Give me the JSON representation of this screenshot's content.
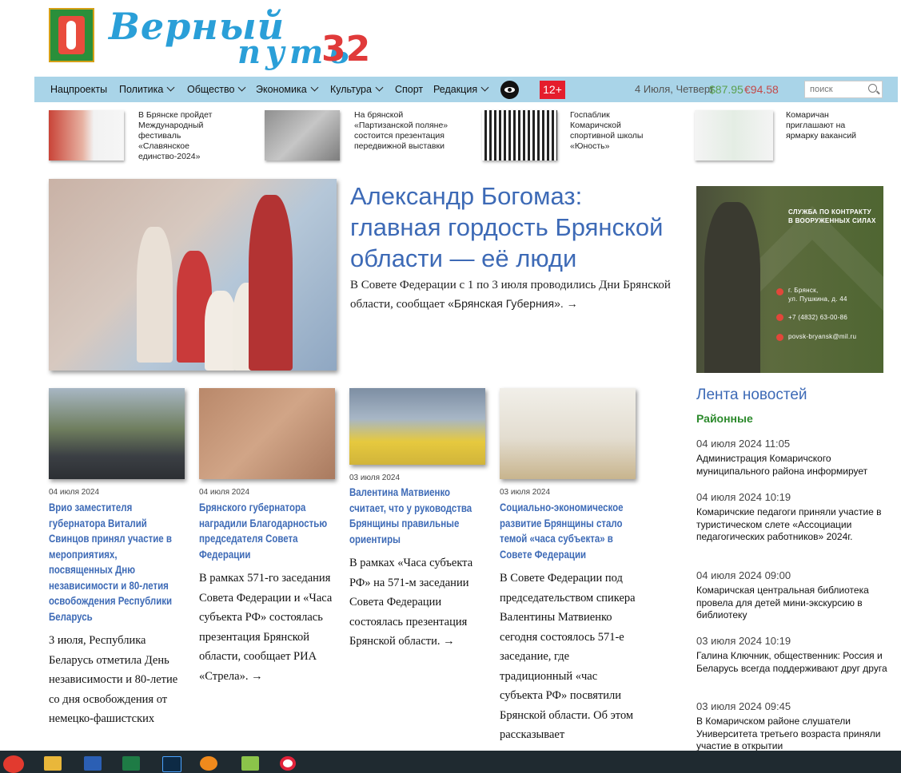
{
  "header": {
    "logo_title": "Верный",
    "logo_sub": "путь",
    "logo_number": "32"
  },
  "nav": {
    "items": [
      {
        "label": "Нацпроекты",
        "dropdown": false
      },
      {
        "label": "Политика",
        "dropdown": true
      },
      {
        "label": "Общество",
        "dropdown": true
      },
      {
        "label": "Экономика",
        "dropdown": true
      },
      {
        "label": "Культура",
        "dropdown": true
      },
      {
        "label": "Спорт",
        "dropdown": false
      },
      {
        "label": "Редакция",
        "dropdown": true
      }
    ],
    "age_rating": "12+",
    "date": "4 Июля, Четверг",
    "usd_rate": "$87.95",
    "eur_rate": "€94.58",
    "search_placeholder": "поиск"
  },
  "strip": [
    {
      "text": "В Брянске пройдет Международный фестиваль «Славянское единство-2024»"
    },
    {
      "text": "На брянской «Партизанской поляне» состоится презентация передвижной выставки"
    },
    {
      "text": "Госпаблик Комаричской спортивной школы «Юность»"
    },
    {
      "text": "Комаричан приглашают на ярмарку вакансий"
    }
  ],
  "main": {
    "title": "Александр Богомаз: главная гордость Брянской области — её люди",
    "lead": "В Совете Федерации с 1 по 3 июля проводились Дни Брянской области, сообщает ",
    "link": "«Брянская Губерния». →"
  },
  "ad": {
    "line1": "СЛУЖБА ПО КОНТРАКТУ",
    "line2": "В ВООРУЖЕННЫХ СИЛАХ",
    "address1": "г. Брянск,",
    "address2": "ул. Пушкина, д. 44",
    "phone": "+7 (4832) 63-00-86",
    "email": "povsk-bryansk@mil.ru"
  },
  "cards": [
    {
      "date": "04 июля 2024",
      "title": "Врио заместителя губернатора Виталий Свинцов принял участие в мероприятиях, посвященных Дню независимости и 80-летия освобождения Республики Беларусь",
      "body": "3 июля, Республика Беларусь отметила День независимости и 80-летие со дня освобождения от немецко-фашистских"
    },
    {
      "date": "04 июля 2024",
      "title": "Брянского губернатора наградили Благодарностью председателя Совета Федерации",
      "body": "В рамках 571-го заседания Совета Федерации и «Часа субъекта РФ» состоялась презентация Брянской области, сообщает РИА «Стрела». →"
    },
    {
      "date": "03 июля 2024",
      "title": "Валентина Матвиенко считает, что у руководства Брянщины правильные ориентиры",
      "body": "В рамках «Часа субъекта РФ» на 571-м заседании Совета Федерации состоялась презентация Брянской области. →"
    },
    {
      "date": "03 июля 2024",
      "title": "Социально-экономическое развитие Брянщины стало темой «часа субъекта» в Совете Федерации",
      "body": "В Совете Федерации под председательством спикера Валентины Матвиенко сегодня состоялось 571-е заседание, где традиционный «час субъекта РФ» посвятили Брянской области. Об этом рассказывает"
    }
  ],
  "feed": {
    "heading": "Лента новостей",
    "subheading": "Районные",
    "items": [
      {
        "date": "04 июля 2024 11:05",
        "text": "Администрация Комаричского муниципального района информирует"
      },
      {
        "date": "04 июля 2024 10:19",
        "text": "Комаричские педагоги приняли участие в туристическом слете «Ассоциации педагогических работников» 2024г."
      },
      {
        "date": "04 июля 2024 09:00",
        "text": "Комаричская центральная библиотека провела для детей мини-экскурсию в библиотеку"
      },
      {
        "date": "03 июля 2024 10:19",
        "text": "Галина Ключник, общественник: Россия и Беларусь всегда поддерживают друг друга"
      },
      {
        "date": "03 июля 2024 09:45",
        "text": "В Комаричском районе слушатели Университета третьего возраста приняли участие в открытии"
      }
    ]
  },
  "taskbar": {
    "icons": [
      "yandex-browser-icon",
      "file-explorer-icon",
      "word-icon",
      "excel-icon",
      "photoshop-icon",
      "settings-icon",
      "media-icon",
      "opera-icon"
    ]
  }
}
